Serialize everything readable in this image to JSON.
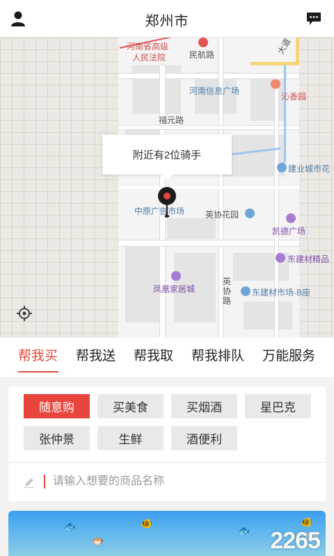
{
  "header": {
    "title": "郑州市",
    "user_icon": "user-icon",
    "message_icon": "chat-bubble-icon"
  },
  "map": {
    "labels": {
      "court": "河南省高级\n人民法院",
      "court_line1": "河南省高级",
      "court_line2": "人民法院",
      "minhang_road": "民航路",
      "avenue": "大道",
      "info_plaza": "河南信息广场",
      "qinxiang_garden": "沁香园",
      "fuyuan_road": "福元路",
      "jianye_city": "建业城市花",
      "zhongyuan_market": "中原广告市场",
      "yingxie_garden": "英协花园",
      "kaide_plaza": "凯德广场",
      "dongjian_boutique": "东建材精品",
      "fenghuang_home": "凤凰家居城",
      "yingxie_road": "英\n协\n路",
      "dongjian_market_b": "东建材市场-B座"
    },
    "bubble_text": "附近有2位骑手",
    "pin_icon": "location-pin-icon",
    "locate_icon": "crosshair-icon"
  },
  "tabs": [
    {
      "label": "帮我买",
      "active": true
    },
    {
      "label": "帮我送",
      "active": false
    },
    {
      "label": "帮我取",
      "active": false
    },
    {
      "label": "帮我排队",
      "active": false
    },
    {
      "label": "万能服务",
      "active": false
    }
  ],
  "chips": [
    {
      "label": "随意购",
      "active": true
    },
    {
      "label": "买美食",
      "active": false
    },
    {
      "label": "买烟酒",
      "active": false
    },
    {
      "label": "星巴克",
      "active": false
    },
    {
      "label": "张仲景",
      "active": false
    },
    {
      "label": "生鲜",
      "active": false
    },
    {
      "label": "酒便利",
      "active": false
    }
  ],
  "search": {
    "placeholder": "请输入想要的商品名称",
    "value": ""
  },
  "watermark": {
    "text": "2265",
    "sub": "手游网"
  },
  "colors": {
    "accent": "#e64a3d",
    "chip_active": "#e8453c",
    "chip_bg": "#e9e9e9"
  }
}
